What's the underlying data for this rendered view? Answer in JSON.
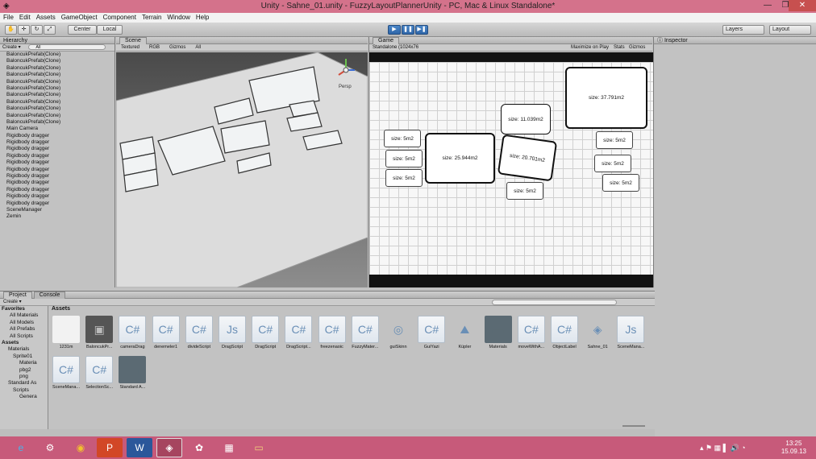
{
  "window": {
    "title": "Unity - Sahne_01.unity - FuzzyLayoutPlannerUnity - PC, Mac & Linux Standalone*",
    "minimize": "—",
    "maximize": "❐",
    "close": "✕"
  },
  "menu": [
    "File",
    "Edit",
    "Assets",
    "GameObject",
    "Component",
    "Terrain",
    "Window",
    "Help"
  ],
  "toolbar": {
    "center": "Center",
    "local": "Local",
    "layers": "Layers",
    "layout": "Layout"
  },
  "hierarchy": {
    "title": "Hierarchy",
    "create": "Create",
    "search": "All",
    "items": [
      "BaloncukPrefab(Clone)",
      "BaloncukPrefab(Clone)",
      "BaloncukPrefab(Clone)",
      "BaloncukPrefab(Clone)",
      "BaloncukPrefab(Clone)",
      "BaloncukPrefab(Clone)",
      "BaloncukPrefab(Clone)",
      "BaloncukPrefab(Clone)",
      "BaloncukPrefab(Clone)",
      "BaloncukPrefab(Clone)",
      "BaloncukPrefab(Clone)",
      "Main Camera",
      "Rigidbody dragger",
      "Rigidbody dragger",
      "Rigidbody dragger",
      "Rigidbody dragger",
      "Rigidbody dragger",
      "Rigidbody dragger",
      "Rigidbody dragger",
      "Rigidbody dragger",
      "Rigidbody dragger",
      "Rigidbody dragger",
      "Rigidbody dragger",
      "SceneManager",
      "Zemin"
    ]
  },
  "scene": {
    "title": "Scene",
    "render_mode": "Textured",
    "color_mode": "RGB",
    "gizmos": "Gizmos",
    "search": "All",
    "persp": "Persp"
  },
  "game": {
    "title": "Game",
    "resolution": "Standalone (1024x76",
    "maximize": "Maximize on Play",
    "stats": "Stats",
    "gizmos": "Gizmos",
    "rooms": [
      {
        "label": "size: 37.791m2"
      },
      {
        "label": "size: 11.039m2"
      },
      {
        "label": "size: 5m2"
      },
      {
        "label": "size: 25.944m2"
      },
      {
        "label": "size: 20.701m2"
      },
      {
        "label": "size: 5m2"
      },
      {
        "label": "size: 5m2"
      },
      {
        "label": "size: 5m2"
      },
      {
        "label": "size: 5m2"
      },
      {
        "label": "size: 5m2"
      },
      {
        "label": "size: 5m2"
      }
    ]
  },
  "inspector": {
    "title": "Inspector"
  },
  "project": {
    "title": "Project",
    "console": "Console",
    "create": "Create",
    "assets_header": "Assets",
    "tree": [
      "Favorites",
      "All Materials",
      "All Models",
      "All Prefabs",
      "All Scripts",
      "Assets",
      "Materials",
      "Sprite01",
      "Materia",
      "pbg2",
      "png",
      "Standard As",
      "Scripts",
      "Genera"
    ],
    "assets": [
      {
        "name": "1231m",
        "icon": "blank-icon"
      },
      {
        "name": "BaloncukPr...",
        "icon": "prefab-cube-icon"
      },
      {
        "name": "cameraDrag",
        "icon": "csharp-script-icon"
      },
      {
        "name": "denemeler1",
        "icon": "csharp-script-icon"
      },
      {
        "name": "divideScript",
        "icon": "csharp-script-icon"
      },
      {
        "name": "DragScript",
        "icon": "js-script-icon"
      },
      {
        "name": "DragScript",
        "icon": "csharp-script-icon"
      },
      {
        "name": "DragScript...",
        "icon": "csharp-script-icon"
      },
      {
        "name": "freezenaoic",
        "icon": "csharp-script-icon"
      },
      {
        "name": "FuzzyMater...",
        "icon": "csharp-script-icon"
      },
      {
        "name": "guiSkinn",
        "icon": "gui-skin-icon"
      },
      {
        "name": "GuiYazi",
        "icon": "csharp-script-icon"
      },
      {
        "name": "Küpler",
        "icon": "terrain-icon"
      },
      {
        "name": "Materials",
        "icon": "folder-icon"
      },
      {
        "name": "moveWithA...",
        "icon": "csharp-script-icon"
      },
      {
        "name": "ObjectLabel",
        "icon": "csharp-script-icon"
      },
      {
        "name": "Sahne_01",
        "icon": "unity-scene-icon"
      },
      {
        "name": "SceneMana...",
        "icon": "js-script-icon"
      },
      {
        "name": "SceneMana...",
        "icon": "csharp-script-icon"
      },
      {
        "name": "SelectionSc...",
        "icon": "csharp-script-icon"
      },
      {
        "name": "Standard A...",
        "icon": "folder-icon"
      }
    ]
  },
  "taskbar": {
    "apps": [
      "internet-explorer-icon",
      "app-icon",
      "chrome-icon",
      "powerpoint-icon",
      "word-icon",
      "unity-icon",
      "app2-icon",
      "app3-icon",
      "file-explorer-icon"
    ],
    "time": "13:25",
    "date": "15.09.13"
  }
}
